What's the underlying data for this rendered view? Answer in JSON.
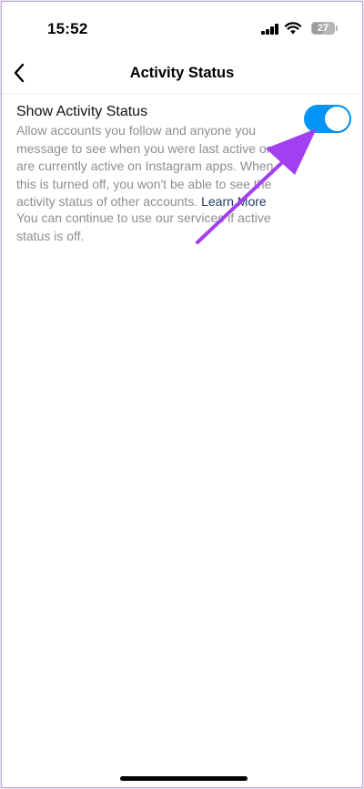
{
  "status_bar": {
    "time": "15:52",
    "battery": "27"
  },
  "nav": {
    "title": "Activity Status"
  },
  "setting": {
    "title": "Show Activity Status",
    "description": "Allow accounts you follow and anyone you message to see when you were last active or are currently active on Instagram apps. When this is turned off, you won't be able to see the activity status of other accounts.",
    "learn_more": "Learn More",
    "enabled": true
  },
  "note": "You can continue to use our services if active status is off.",
  "colors": {
    "toggle_on": "#0095f6",
    "link": "#223a63",
    "annotation_arrow": "#a23ff0"
  },
  "icons": {
    "back": "chevron-left-icon",
    "signal": "cellular-signal-icon",
    "wifi": "wifi-icon",
    "battery": "battery-icon"
  }
}
